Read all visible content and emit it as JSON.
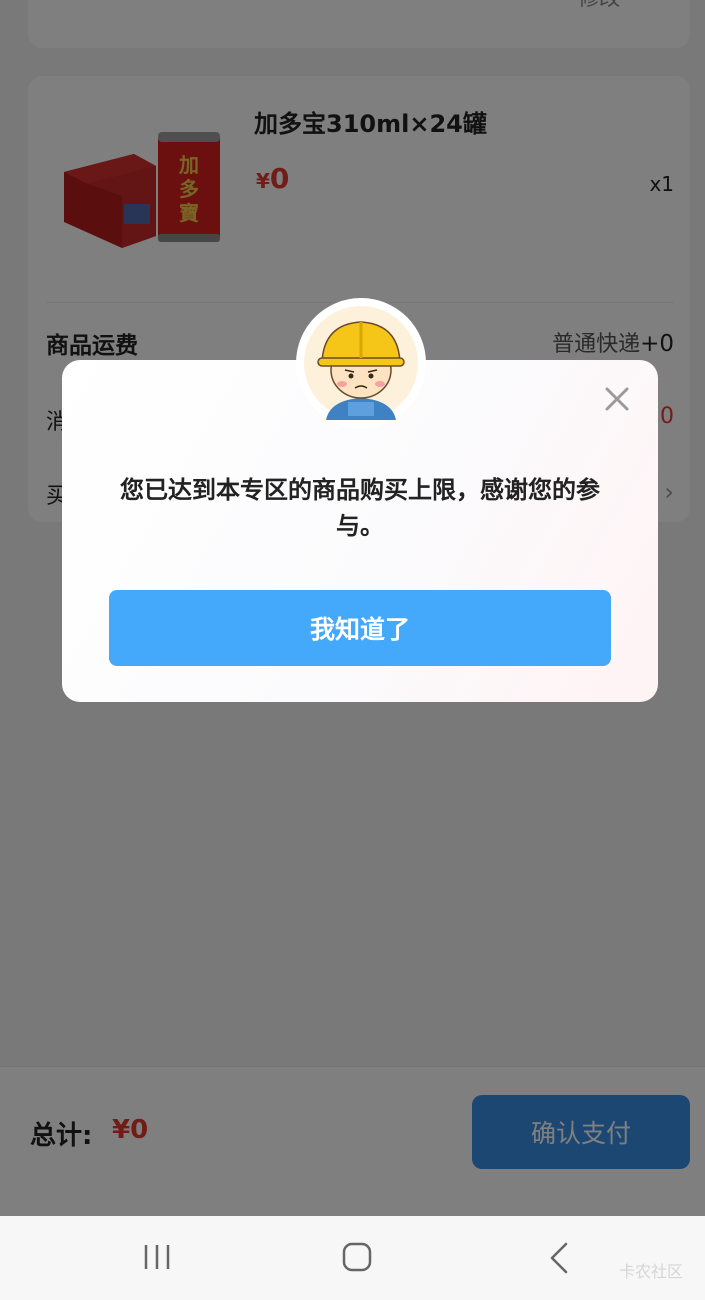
{
  "address": {
    "edit_label": "修改"
  },
  "product": {
    "name": "加多宝310ml×24罐",
    "price_symbol": "¥",
    "price": "0",
    "quantity": "x1",
    "image_icon": "product-image-jiaduobao"
  },
  "rows": {
    "shipping_label": "商品运费",
    "shipping_method": "普通快递",
    "shipping_value": "+0",
    "consume_label": "消",
    "consume_value": "0",
    "buy_label": "买",
    "buy_arrow": "›"
  },
  "footer": {
    "total_label": "总计:",
    "total_value": "¥0",
    "pay_label": "确认支付"
  },
  "modal": {
    "message": "您已达到本专区的商品购买上限，感谢您的参与。",
    "confirm_label": "我知道了",
    "close_icon": "close-icon",
    "avatar_icon": "worker-avatar-icon"
  },
  "watermark": "卡农社区",
  "colors": {
    "price_red": "#e23a2e",
    "primary_blue": "#44a8fb",
    "pay_blue": "#3a8ee6"
  }
}
